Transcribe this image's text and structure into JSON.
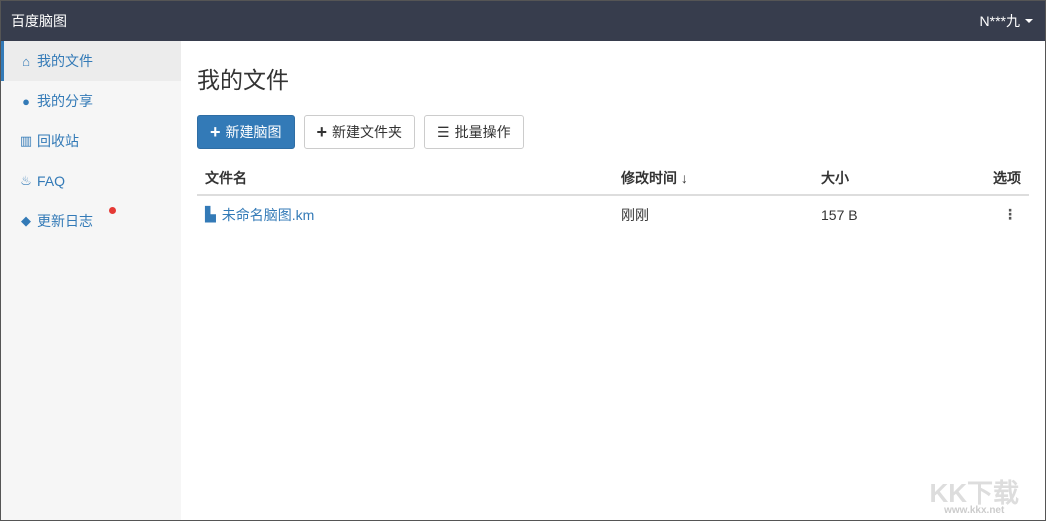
{
  "header": {
    "brand": "百度脑图",
    "user": "N***九"
  },
  "sidebar": {
    "items": [
      {
        "label": "我的文件",
        "icon": "home-icon"
      },
      {
        "label": "我的分享",
        "icon": "globe-icon"
      },
      {
        "label": "回收站",
        "icon": "trash-icon"
      },
      {
        "label": "FAQ",
        "icon": "fire-icon"
      },
      {
        "label": "更新日志",
        "icon": "tags-icon"
      }
    ]
  },
  "main": {
    "title": "我的文件",
    "buttons": {
      "new_mindmap": "新建脑图",
      "new_folder": "新建文件夹",
      "batch": "批量操作"
    },
    "table": {
      "headers": {
        "name": "文件名",
        "modified": "修改时间",
        "size": "大小",
        "options": "选项"
      },
      "rows": [
        {
          "name": "未命名脑图.km",
          "modified": "刚刚",
          "size": "157 B"
        }
      ]
    }
  },
  "watermark": {
    "text": "KK下载",
    "url": "www.kkx.net"
  }
}
